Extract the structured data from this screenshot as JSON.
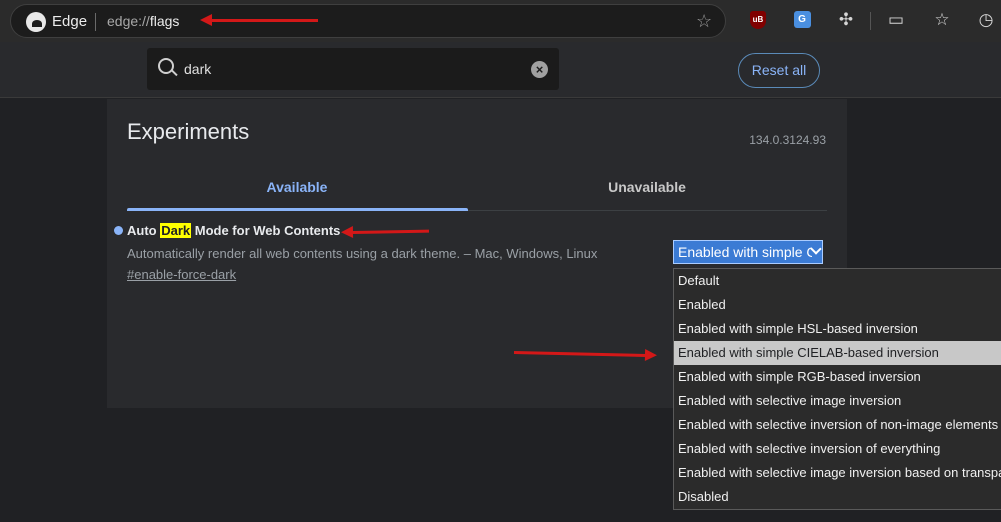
{
  "browser": {
    "brand": "Edge",
    "url_scheme": "edge://",
    "url_path": "flags",
    "icons": [
      "star-icon",
      "ublock-icon",
      "translate-icon",
      "puzzle-icon",
      "cast-icon",
      "favorites-icon",
      "history-icon"
    ]
  },
  "search": {
    "value": "dark",
    "clear_symbol": "×"
  },
  "header": {
    "reset_label": "Reset all"
  },
  "main": {
    "title": "Experiments",
    "version": "134.0.3124.93",
    "tabs": [
      {
        "label": "Available",
        "active": true
      },
      {
        "label": "Unavailable",
        "active": false
      }
    ]
  },
  "flag": {
    "title_before": "Auto ",
    "title_highlight": "Dark",
    "title_after": " Mode for Web Contents",
    "description": "Automatically render all web contents using a dark theme. – Mac, Windows, Linux",
    "link": "#enable-force-dark",
    "selected_value": "Enabled with simple CIELAB-based inversion"
  },
  "dropdown": {
    "options": [
      "Default",
      "Enabled",
      "Enabled with simple HSL-based inversion",
      "Enabled with simple CIELAB-based inversion",
      "Enabled with simple RGB-based inversion",
      "Enabled with selective image inversion",
      "Enabled with selective inversion of non-image elements",
      "Enabled with selective inversion of everything",
      "Enabled with selective image inversion based on transparency and number of colors",
      "Disabled"
    ],
    "selected_index": 3
  },
  "colors": {
    "accent": "#8ab4f8",
    "annotation": "#d31818",
    "highlight": "#ffff00"
  }
}
